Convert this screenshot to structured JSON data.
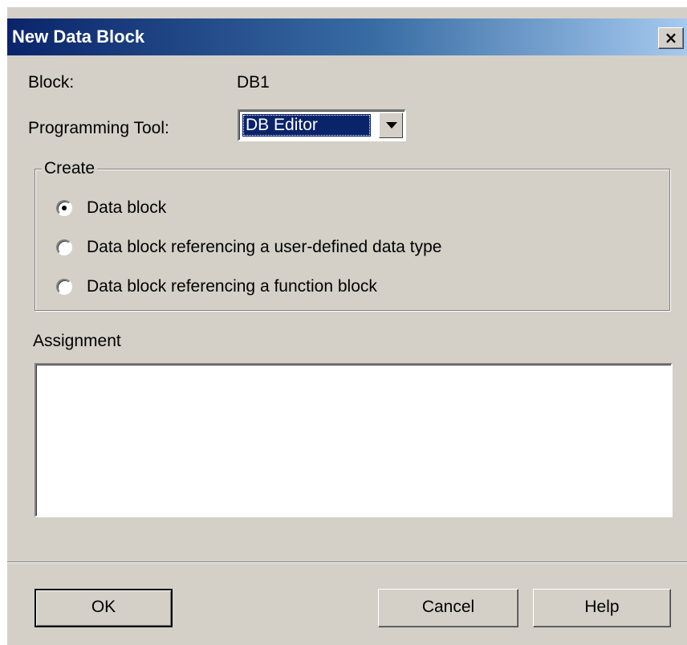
{
  "window": {
    "title": "New Data Block",
    "close_label": "×"
  },
  "fields": {
    "block_label": "Block:",
    "block_value": "DB1",
    "tool_label": "Programming Tool:",
    "tool_value": "DB Editor"
  },
  "create": {
    "legend": "Create",
    "options": [
      {
        "label": "Data block",
        "checked": true
      },
      {
        "label": "Data block referencing a user-defined data type",
        "checked": false
      },
      {
        "label": "Data block referencing a function block",
        "checked": false
      }
    ]
  },
  "assignment": {
    "label": "Assignment",
    "value": ""
  },
  "buttons": {
    "ok": "OK",
    "cancel": "Cancel",
    "help": "Help"
  }
}
